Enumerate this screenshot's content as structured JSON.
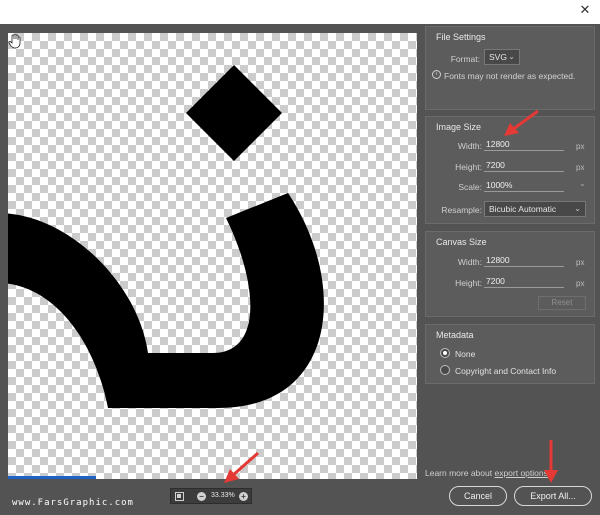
{
  "window": {
    "close_glyph": "✕"
  },
  "file_settings": {
    "title": "File Settings",
    "format_label": "Format:",
    "format_value": "SVG",
    "notice": "Fonts may not render as expected."
  },
  "image_size": {
    "title": "Image Size",
    "width_label": "Width:",
    "width_value": "12800",
    "height_label": "Height:",
    "height_value": "7200",
    "scale_label": "Scale:",
    "scale_value": "1000%",
    "resample_label": "Resample:",
    "resample_value": "Bicubic Automatic",
    "unit": "px"
  },
  "canvas_size": {
    "title": "Canvas Size",
    "width_label": "Width:",
    "width_value": "12800",
    "height_label": "Height:",
    "height_value": "7200",
    "unit": "px",
    "reset_label": "Reset"
  },
  "metadata": {
    "title": "Metadata",
    "options": [
      "None",
      "Copyright and Contact Info"
    ],
    "selected": "None"
  },
  "footer": {
    "learn_prefix": "Learn more about ",
    "learn_link": "export options",
    "cancel_label": "Cancel",
    "export_label": "Export All...",
    "zoom_value": "33.33%"
  },
  "watermark": "www.FarsGraphic.com",
  "colors": {
    "annotation_arrow": "#e53935",
    "accent_bar": "#1e63c4"
  }
}
